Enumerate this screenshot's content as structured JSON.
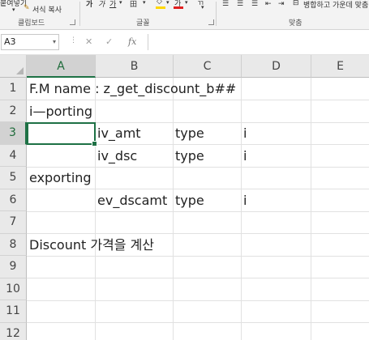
{
  "ribbon": {
    "clipboard": {
      "paste_label": "붙여넣기",
      "format_painter_label": "서식 복사",
      "group_label": "클립보드"
    },
    "font": {
      "bold": "가",
      "italic": "가",
      "underline": "가",
      "group_label": "글꼴",
      "font_color_glyph": "가"
    },
    "alignment": {
      "merge_label": "병합하고 가운데 맞춤",
      "group_label": "맞춤"
    },
    "colors": {
      "fill": "#ffd700",
      "font_color": "#e02020"
    }
  },
  "formula_bar": {
    "name_box": "A3",
    "cancel_icon": "close-icon",
    "enter_icon": "check-icon",
    "fx_label": "fx",
    "formula_value": ""
  },
  "grid": {
    "columns": [
      "A",
      "B",
      "C",
      "D",
      "E"
    ],
    "rows": [
      "1",
      "2",
      "3",
      "4",
      "5",
      "6",
      "7",
      "8",
      "9",
      "10",
      "11",
      "12"
    ],
    "active_cell": "A3",
    "accent": "#1e7145",
    "cells": {
      "r1": {
        "a": "F.M name : z_get_discount_b##"
      },
      "r2": {
        "a": "i—porting"
      },
      "r3": {
        "b": "iv_amt",
        "c": "type",
        "d": "i"
      },
      "r4": {
        "b": "iv_dsc",
        "c": "type",
        "d": "i"
      },
      "r5": {
        "a": "exporting"
      },
      "r6": {
        "b": "ev_dscamt",
        "c": "type",
        "d": "i"
      },
      "r8": {
        "a": "Discount 가격을 계산"
      }
    }
  }
}
